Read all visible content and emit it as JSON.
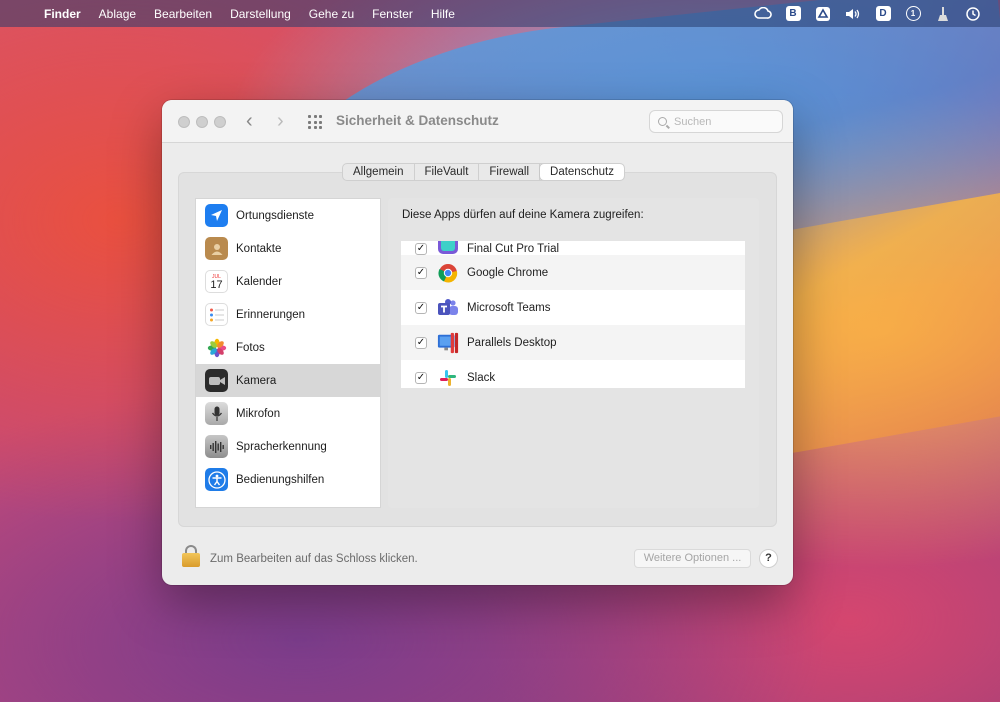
{
  "menubar": {
    "app": "Finder",
    "items": [
      "Ablage",
      "Bearbeiten",
      "Darstellung",
      "Gehe zu",
      "Fenster",
      "Hilfe"
    ],
    "tray_text": {
      "b": "B",
      "d": "D",
      "one": "1"
    }
  },
  "window": {
    "title": "Sicherheit & Datenschutz",
    "search_placeholder": "Suchen",
    "tabs": [
      "Allgemein",
      "FileVault",
      "Firewall",
      "Datenschutz"
    ],
    "active_tab": "Datenschutz",
    "sidebar": [
      {
        "label": "Ortungsdienste",
        "icon": "location-icon",
        "color": "#1e7ef0"
      },
      {
        "label": "Kontakte",
        "icon": "contacts-icon",
        "color": "#b98a4e"
      },
      {
        "label": "Kalender",
        "icon": "calendar-icon",
        "color": "#ffffff"
      },
      {
        "label": "Erinnerungen",
        "icon": "reminders-icon",
        "color": "#ffffff"
      },
      {
        "label": "Fotos",
        "icon": "photos-icon",
        "color": "#ffffff"
      },
      {
        "label": "Kamera",
        "icon": "camera-icon",
        "color": "#2b2b2b"
      },
      {
        "label": "Mikrofon",
        "icon": "microphone-icon",
        "color": "#c8c8c8"
      },
      {
        "label": "Spracherkennung",
        "icon": "speech-icon",
        "color": "#9a9a9a"
      },
      {
        "label": "Bedienungshilfen",
        "icon": "accessibility-icon",
        "color": "#1f7ce8"
      }
    ],
    "selected_item": "Kamera",
    "calendar_month": "JUL",
    "calendar_day": "17",
    "pane_heading": "Diese Apps dürfen auf deine Kamera zugreifen:",
    "apps": [
      {
        "name": "Final Cut Pro Trial",
        "checked": true,
        "icon": "final-cut-icon"
      },
      {
        "name": "Google Chrome",
        "checked": true,
        "icon": "chrome-icon"
      },
      {
        "name": "Microsoft Teams",
        "checked": true,
        "icon": "teams-icon"
      },
      {
        "name": "Parallels Desktop",
        "checked": true,
        "icon": "parallels-icon"
      },
      {
        "name": "Slack",
        "checked": true,
        "icon": "slack-icon"
      }
    ],
    "checkmark": "✓",
    "lock_text": "Zum Bearbeiten auf das Schloss klicken.",
    "more_button": "Weitere Optionen ...",
    "help_button": "?"
  }
}
